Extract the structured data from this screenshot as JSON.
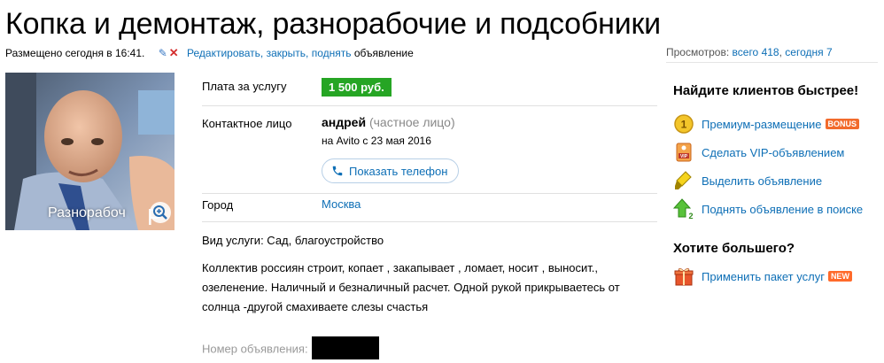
{
  "title": "Копка и демонтаж, разнорабочие и подсобники",
  "meta": {
    "posted": "Размещено сегодня в 16:41.",
    "edit_link": "Редактировать, закрыть, поднять",
    "edit_suffix": "объявление"
  },
  "views": {
    "label": "Просмотров:",
    "total": "всего 418",
    "sep": ",",
    "today": "сегодня 7"
  },
  "photo": {
    "caption": "Разнорабоч",
    "letter": "P"
  },
  "fields": {
    "price_label": "Плата за услугу",
    "price": "1 500 руб.",
    "contact_label": "Контактное лицо",
    "contact_name": "андрей",
    "contact_type": "(частное лицо)",
    "since": "на Avito с 23 мая 2016",
    "phone_button": "Показать телефон",
    "city_label": "Город",
    "city": "Москва",
    "service": "Вид услуги: Сад, благоустройство",
    "description": "Коллектив россиян строит, копает , закапывает , ломает, носит , выносит., озеленение. Наличный и безналичный расчет. Одной рукой прикрываетесь от солнца -другой смахиваете слезы счастья",
    "ad_number_label": "Номер объявления:"
  },
  "sidebar": {
    "heading1": "Найдите клиентов быстрее!",
    "items": [
      {
        "label": "Премиум-размещение",
        "badge": "BONUS",
        "icon": "premium-coin-icon"
      },
      {
        "label": "Сделать VIP-объявлением",
        "badge": "",
        "icon": "vip-icon"
      },
      {
        "label": "Выделить объявление",
        "badge": "",
        "icon": "highlighter-icon"
      },
      {
        "label": "Поднять объявление в поиске",
        "badge": "",
        "icon": "up-arrow-icon"
      }
    ],
    "heading2": "Хотите большего?",
    "package": {
      "label": "Применить пакет услуг",
      "badge": "NEW",
      "icon": "package-icon"
    }
  },
  "colors": {
    "link": "#0e6fb6",
    "price_bg": "#26a524",
    "badge": "#f26b2c"
  }
}
